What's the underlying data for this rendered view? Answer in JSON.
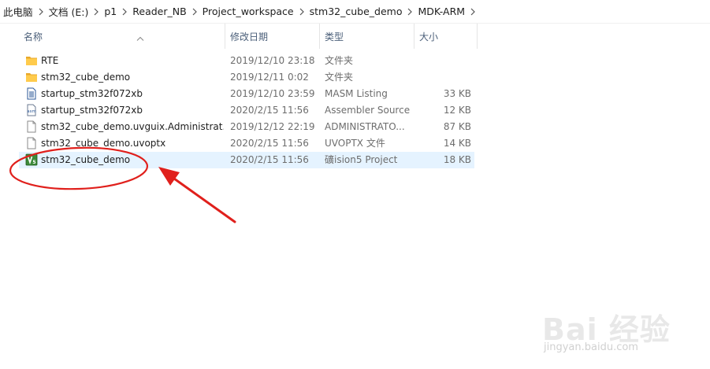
{
  "breadcrumb": [
    "此电脑",
    "文档 (E:)",
    "p1",
    "Reader_NB",
    "Project_workspace",
    "stm32_cube_demo",
    "MDK-ARM"
  ],
  "columns": {
    "name": "名称",
    "date": "修改日期",
    "type": "类型",
    "size": "大小"
  },
  "files": [
    {
      "icon": "folder-icon",
      "name": "RTE",
      "date": "2019/12/10 23:18",
      "type": "文件夹",
      "size": ""
    },
    {
      "icon": "folder-icon",
      "name": "stm32_cube_demo",
      "date": "2019/12/11 0:02",
      "type": "文件夹",
      "size": ""
    },
    {
      "icon": "listing-file-icon",
      "name": "startup_stm32f072xb",
      "date": "2019/12/10 23:59",
      "type": "MASM Listing",
      "size": "33 KB"
    },
    {
      "icon": "asm-file-icon",
      "name": "startup_stm32f072xb",
      "date": "2020/2/15 11:56",
      "type": "Assembler Source",
      "size": "12 KB"
    },
    {
      "icon": "blank-file-icon",
      "name": "stm32_cube_demo.uvguix.Administrat...",
      "date": "2019/12/12 22:19",
      "type": "ADMINISTRATO...",
      "size": "87 KB"
    },
    {
      "icon": "blank-file-icon",
      "name": "stm32_cube_demo.uvoptx",
      "date": "2020/2/15 11:56",
      "type": "UVOPTX 文件",
      "size": "14 KB"
    },
    {
      "icon": "uvision-project-icon",
      "name": "stm32_cube_demo",
      "date": "2020/2/15 11:56",
      "type": "礦ision5 Project",
      "size": "18 KB",
      "selected": true
    }
  ],
  "watermark": {
    "brand": "Bai 经验",
    "domain": "jingyan.baidu.com"
  },
  "colors": {
    "selection": "#e5f3ff",
    "annotation": "#e0201c",
    "header_text": "#4c607a",
    "folder": "#ffc83d",
    "uvision_green": "#3c8a3a"
  }
}
